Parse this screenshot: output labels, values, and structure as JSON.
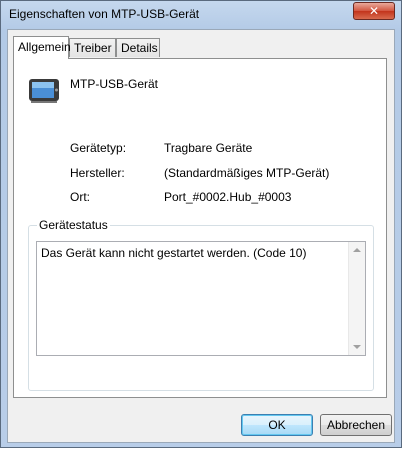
{
  "window": {
    "title": "Eigenschaften von MTP-USB-Gerät",
    "close_symbol": "✕"
  },
  "tabs": [
    {
      "label": "Allgemein",
      "active": true
    },
    {
      "label": "Treiber",
      "active": false
    },
    {
      "label": "Details",
      "active": false
    }
  ],
  "general": {
    "device_name": "MTP-USB-Gerät",
    "icon": "portable-device-icon",
    "properties": [
      {
        "label": "Gerätetyp:",
        "value": "Tragbare Geräte"
      },
      {
        "label": "Hersteller:",
        "value": "(Standardmäßiges MTP-Gerät)"
      },
      {
        "label": "Ort:",
        "value": "Port_#0002.Hub_#0003"
      }
    ],
    "status_group_title": "Gerätestatus",
    "status_text": "Das Gerät kann nicht gestartet werden. (Code 10)"
  },
  "buttons": {
    "ok": "OK",
    "cancel": "Abbrechen"
  }
}
